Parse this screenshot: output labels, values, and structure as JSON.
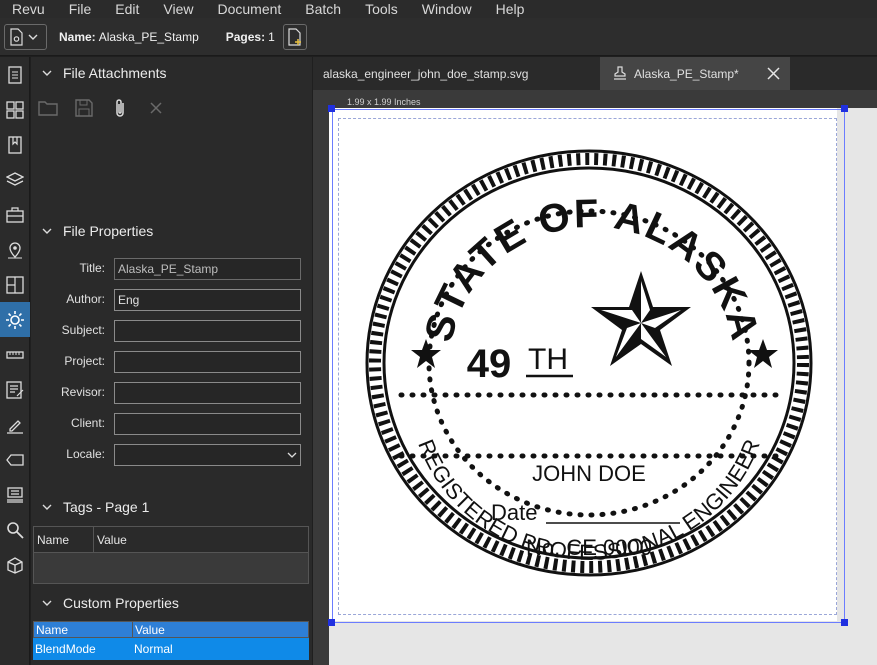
{
  "menu": [
    "Revu",
    "File",
    "Edit",
    "View",
    "Document",
    "Batch",
    "Tools",
    "Window",
    "Help"
  ],
  "toolbar": {
    "name_label": "Name:",
    "name_value": "Alaska_PE_Stamp",
    "pages_label": "Pages:",
    "pages_value": "1"
  },
  "rail_icons": [
    "thumbnails-icon",
    "grid-icon",
    "bookmarks-icon",
    "layers-icon",
    "toolchest-icon",
    "places-icon",
    "pdf-layout-icon",
    "properties-icon",
    "measure-icon",
    "markup-list-icon",
    "signature-icon",
    "tag-icon",
    "stamp-icon",
    "search-icon",
    "shape-icon"
  ],
  "panel": {
    "attachments_title": "File Attachments",
    "properties_title": "File Properties",
    "tags_title": "Tags - Page 1",
    "custom_title": "Custom Properties",
    "fields": [
      {
        "label": "Title:",
        "value": "Alaska_PE_Stamp"
      },
      {
        "label": "Author:",
        "value": "Eng"
      },
      {
        "label": "Subject:",
        "value": ""
      },
      {
        "label": "Project:",
        "value": ""
      },
      {
        "label": "Revisor:",
        "value": ""
      },
      {
        "label": "Client:",
        "value": ""
      },
      {
        "label": "Locale:",
        "value": ""
      }
    ],
    "tags_columns": [
      "Name",
      "Value"
    ],
    "custom_columns": [
      "Name",
      "Value"
    ],
    "custom_rows": [
      {
        "name": "BlendMode",
        "value": "Normal"
      }
    ]
  },
  "tabs": {
    "tab1": "alaska_engineer_john_doe_stamp.svg",
    "tab2": "Alaska_PE_Stamp*"
  },
  "page": {
    "dimensions": "1.99 x 1.99 Inches"
  },
  "stamp": {
    "top_arc": "STATE OF ALASKA",
    "bottom_arc": "REGISTERED PROFESSIONAL ENGINEER",
    "number": "49",
    "suffix": "TH",
    "name": "JOHN DOE",
    "date_label": "Date",
    "license": "No. CE 0000"
  },
  "colors": {
    "accent": "#2f6fa8",
    "selected_row": "#0f8ae8",
    "handle": "#2030e0"
  }
}
